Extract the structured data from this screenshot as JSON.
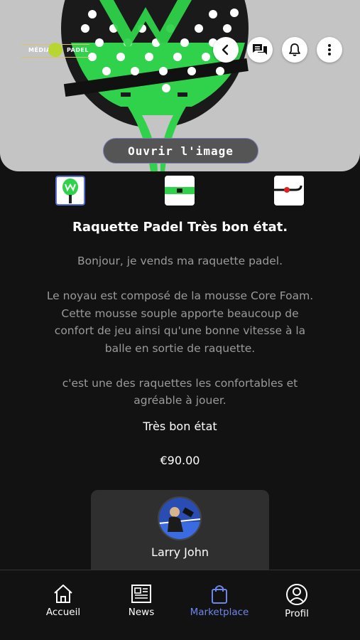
{
  "hero": {
    "logo": {
      "left_text": "MÉDIA",
      "right_text": "PADEL"
    },
    "actions": {
      "back_icon": "chevron-left",
      "chat_icon": "chat-bubbles",
      "notifications_icon": "bell",
      "more_icon": "vertical-dots"
    },
    "open_image_label": "Ouvrir l'image"
  },
  "thumbnails": [
    {
      "name": "racket-front",
      "selected": true
    },
    {
      "name": "racket-handle",
      "selected": false
    },
    {
      "name": "racket-strap",
      "selected": false
    }
  ],
  "product": {
    "title": "Raquette Padel Très bon état.",
    "description": [
      "Bonjour, je vends ma raquette padel.",
      "",
      "Le noyau est composé de la mousse Core Foam.",
      "Cette mousse souple apporte beaucoup de",
      "confort de jeu ainsi qu'une bonne vitesse à la",
      "balle en sortie de raquette.",
      "",
      "c'est une des raquettes les confortables et",
      "agréable à jouer."
    ],
    "condition": "Très bon état",
    "price": "€90.00"
  },
  "seller": {
    "name": "Larry John"
  },
  "nav": {
    "items": [
      {
        "label": "Accueil",
        "icon": "home",
        "active": false
      },
      {
        "label": "News",
        "icon": "newspaper",
        "active": false
      },
      {
        "label": "Marketplace",
        "icon": "shopping-bag",
        "active": true
      },
      {
        "label": "Profil",
        "icon": "user-circle",
        "active": false
      }
    ]
  },
  "colors": {
    "accent": "#6e86ea",
    "racket_green": "#2fd24a",
    "background": "#121212"
  }
}
